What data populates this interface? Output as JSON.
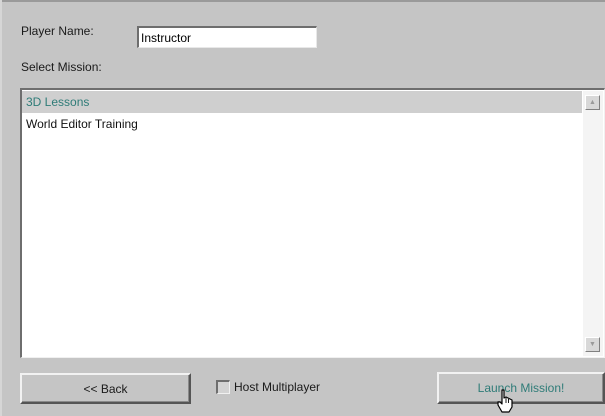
{
  "form": {
    "player_name_label": "Player Name:",
    "player_name_value": "Instructor",
    "select_mission_label": "Select Mission:"
  },
  "missions": {
    "items": [
      {
        "label": "3D Lessons",
        "selected": true
      },
      {
        "label": "World Editor Training",
        "selected": false
      }
    ]
  },
  "footer": {
    "back_label": "<< Back",
    "host_multiplayer_label": "Host Multiplayer",
    "host_multiplayer_checked": false,
    "launch_label": "Launch Mission!"
  },
  "colors": {
    "background": "#c5c5c5",
    "selection_text": "#2f7c78",
    "selection_bg": "#cfcfcf"
  },
  "icons": {
    "scroll_up": "scroll-up-arrow-icon",
    "scroll_down": "scroll-down-arrow-icon",
    "cursor": "hand-pointer-cursor-icon"
  }
}
